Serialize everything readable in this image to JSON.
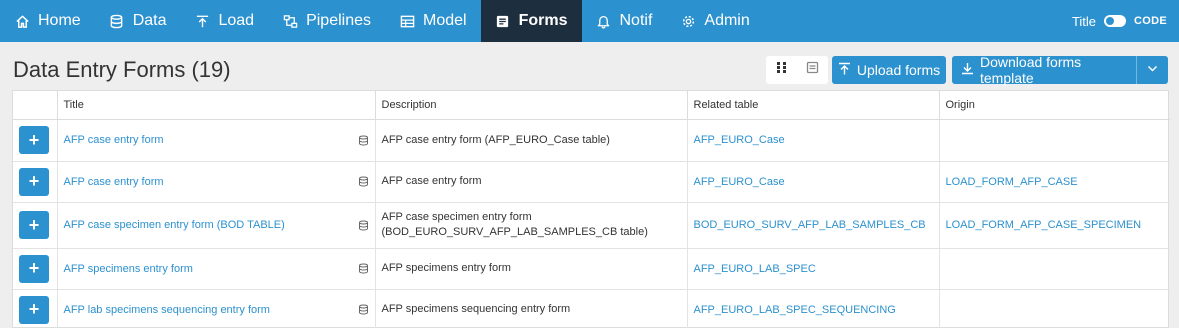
{
  "nav": {
    "items": [
      {
        "label": "Home",
        "icon": "home-icon"
      },
      {
        "label": "Data",
        "icon": "database-icon"
      },
      {
        "label": "Load",
        "icon": "upload-arrow-icon"
      },
      {
        "label": "Pipelines",
        "icon": "pipelines-icon"
      },
      {
        "label": "Model",
        "icon": "model-icon"
      },
      {
        "label": "Forms",
        "icon": "forms-icon"
      },
      {
        "label": "Notif",
        "icon": "bell-icon"
      },
      {
        "label": "Admin",
        "icon": "gear-icon"
      }
    ],
    "active": "Forms",
    "right": {
      "title_label": "Title",
      "code_label": "CODE"
    }
  },
  "page": {
    "title": "Data Entry Forms (19)"
  },
  "toolbar": {
    "upload_label": "Upload forms",
    "download_label": "Download forms template"
  },
  "table": {
    "headers": [
      "",
      "Title",
      "Description",
      "Related table",
      "Origin"
    ],
    "rows": [
      {
        "title": "AFP case entry form",
        "description": "AFP case entry form (AFP_EURO_Case table)",
        "related": "AFP_EURO_Case",
        "origin": ""
      },
      {
        "title": "AFP case entry form",
        "description": "AFP case entry form",
        "related": "AFP_EURO_Case",
        "origin": "LOAD_FORM_AFP_CASE"
      },
      {
        "title": "AFP case specimen entry form (BOD TABLE)",
        "description": "AFP case specimen entry form (BOD_EURO_SURV_AFP_LAB_SAMPLES_CB  table)",
        "related": "BOD_EURO_SURV_AFP_LAB_SAMPLES_CB",
        "origin": "LOAD_FORM_AFP_CASE_SPECIMEN"
      },
      {
        "title": "AFP specimens entry form",
        "description": "AFP specimens entry form",
        "related": "AFP_EURO_LAB_SPEC",
        "origin": ""
      },
      {
        "title": "AFP lab specimens sequencing entry form",
        "description": "AFP specimens sequencing entry form",
        "related": "AFP_EURO_LAB_SPEC_SEQUENCING",
        "origin": ""
      }
    ]
  },
  "colors": {
    "accent": "#2c91cf",
    "active_nav": "#1d2f3f",
    "background": "#eeeeee"
  }
}
